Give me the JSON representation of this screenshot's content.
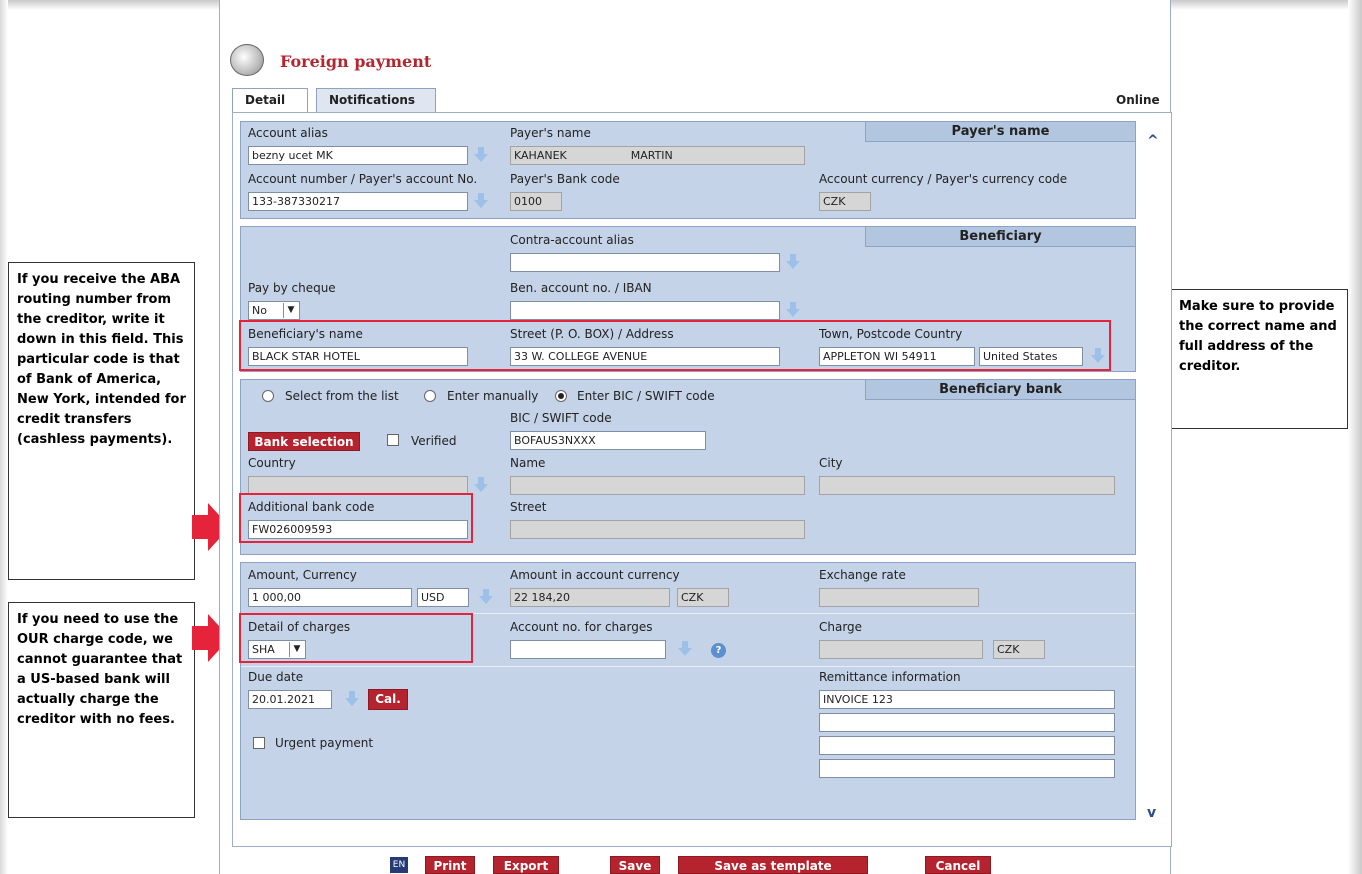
{
  "title": "Foreign payment",
  "tabs": [
    "Detail",
    "Notifications"
  ],
  "status": "Online",
  "payer": {
    "header": "Payer's name",
    "account_alias_label": "Account alias",
    "account_alias_value": "bezny ucet MK",
    "payer_name_label": "Payer's name",
    "payer_name_first": "KAHANEK",
    "payer_name_last": "MARTIN",
    "account_number_label": "Account number / Payer's account No.",
    "account_number_value": "133-387330217",
    "bank_code_label": "Payer's Bank code",
    "bank_code_value": "0100",
    "currency_label": "Account currency / Payer's currency code",
    "currency_value": "CZK"
  },
  "beneficiary": {
    "header": "Beneficiary",
    "contra_alias_label": "Contra-account alias",
    "pay_by_cheque_label": "Pay by cheque",
    "pay_by_cheque_value": "No",
    "account_label": "Ben. account no. / IBAN",
    "name_label": "Beneficiary's name",
    "name_value": "BLACK STAR HOTEL",
    "street_label": "Street (P. O. BOX) / Address",
    "street_value": "33 W. COLLEGE AVENUE",
    "town_label": "Town, Postcode Country",
    "town_value": "APPLETON WI 54911",
    "country_value": "United States"
  },
  "bank": {
    "header": "Beneficiary bank",
    "radio_list": "Select from the list",
    "radio_manual": "Enter manually",
    "radio_bic": "Enter BIC / SWIFT code",
    "bic_label": "BIC / SWIFT code",
    "bic_value": "BOFAUS3NXXX",
    "bank_selection": "Bank selection",
    "verified": "Verified",
    "country_label": "Country",
    "name_label": "Name",
    "city_label": "City",
    "additional_code_label": "Additional bank code",
    "additional_code_value": "FW026009593",
    "street_label": "Street"
  },
  "amount": {
    "amount_label": "Amount, Currency",
    "amount_value": "1 000,00",
    "currency_value": "USD",
    "acc_currency_label": "Amount in account currency",
    "acc_currency_value": "22 184,20",
    "acc_currency_code": "CZK",
    "rate_label": "Exchange rate",
    "charges_label": "Detail of charges",
    "charges_value": "SHA",
    "charges_account_label": "Account no. for charges",
    "charge_label": "Charge",
    "charge_currency": "CZK",
    "due_date_label": "Due date",
    "due_date_value": "20.01.2021",
    "cal": "Cal.",
    "remittance_label": "Remittance information",
    "remittance_value": "INVOICE 123",
    "urgent_label": "Urgent payment"
  },
  "footer": {
    "lang": "EN",
    "print": "Print",
    "export": "Export",
    "save": "Save",
    "save_template": "Save as template",
    "cancel": "Cancel"
  },
  "notes": {
    "left_top": "If you receive the ABA routing number from the creditor, write it down in this field. This particular code is that of Bank of America, New York, intended for credit transfers (cashless payments).",
    "left_bottom": "If you need to use the OUR charge code, we cannot guarantee that a US-based bank will actually charge the creditor with no fees.",
    "right": "Make sure to provide the correct name and full address of the creditor."
  },
  "colors": {
    "accent_red": "#b5232f",
    "highlight_red": "#e5243b",
    "panel_blue": "#c4d3e8"
  }
}
